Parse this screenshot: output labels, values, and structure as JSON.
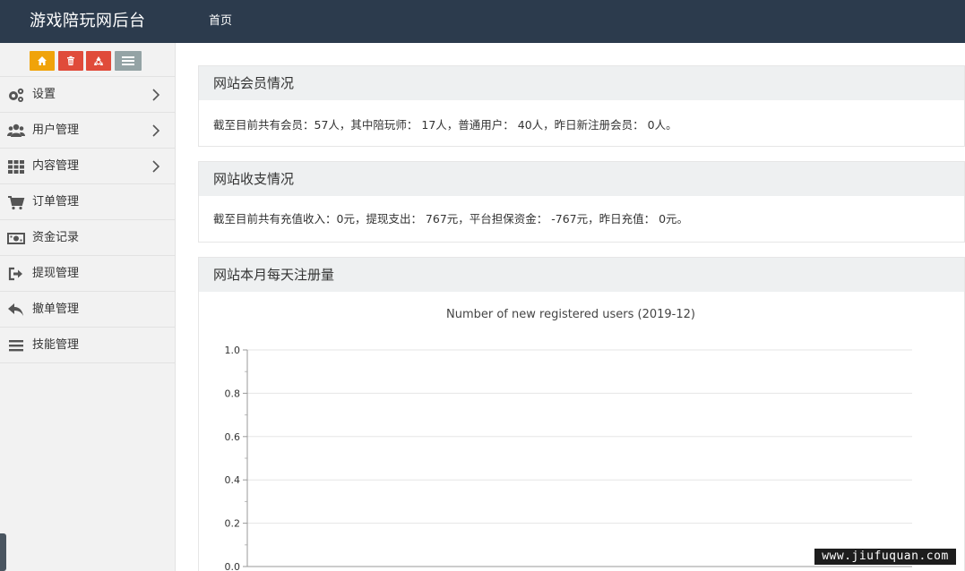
{
  "header": {
    "title": "游戏陪玩网后台",
    "nav_home": "首页"
  },
  "shortcuts": [
    {
      "icon": "home-icon",
      "color": "#f0a30a"
    },
    {
      "icon": "trash-icon",
      "color": "#e04b3a"
    },
    {
      "icon": "recycle-icon",
      "color": "#e04b3a"
    },
    {
      "icon": "list-icon",
      "color": "#94a3a5"
    }
  ],
  "sidebar": {
    "items": [
      {
        "label": "设置",
        "icon": "gears-icon",
        "has_children": true
      },
      {
        "label": "用户管理",
        "icon": "users-icon",
        "has_children": true
      },
      {
        "label": "内容管理",
        "icon": "grid-icon",
        "has_children": true
      },
      {
        "label": "订单管理",
        "icon": "cart-icon",
        "has_children": false
      },
      {
        "label": "资金记录",
        "icon": "money-icon",
        "has_children": false
      },
      {
        "label": "提现管理",
        "icon": "sign-out-icon",
        "has_children": false
      },
      {
        "label": "撤单管理",
        "icon": "reply-icon",
        "has_children": false
      },
      {
        "label": "技能管理",
        "icon": "bars-icon",
        "has_children": false
      }
    ]
  },
  "members": {
    "title": "网站会员情况",
    "text": "截至目前共有会员：57人，其中陪玩师： 17人，普通用户： 40人，昨日新注册会员： 0人。"
  },
  "finance": {
    "title": "网站收支情况",
    "text": "截至目前共有充值收入：0元，提现支出： 767元，平台担保资金： -767元，昨日充值： 0元。"
  },
  "registrations": {
    "title": "网站本月每天注册量"
  },
  "chart_data": {
    "type": "line",
    "title": "Number of new registered users (2019-12)",
    "xlabel": "",
    "ylabel": "",
    "ylim": [
      0,
      1.0
    ],
    "yticks": [
      "0.0",
      "0.2",
      "0.4",
      "0.6",
      "0.8",
      "1.0"
    ],
    "grid": true,
    "series": []
  },
  "watermark": "www.jiufuquan.com"
}
